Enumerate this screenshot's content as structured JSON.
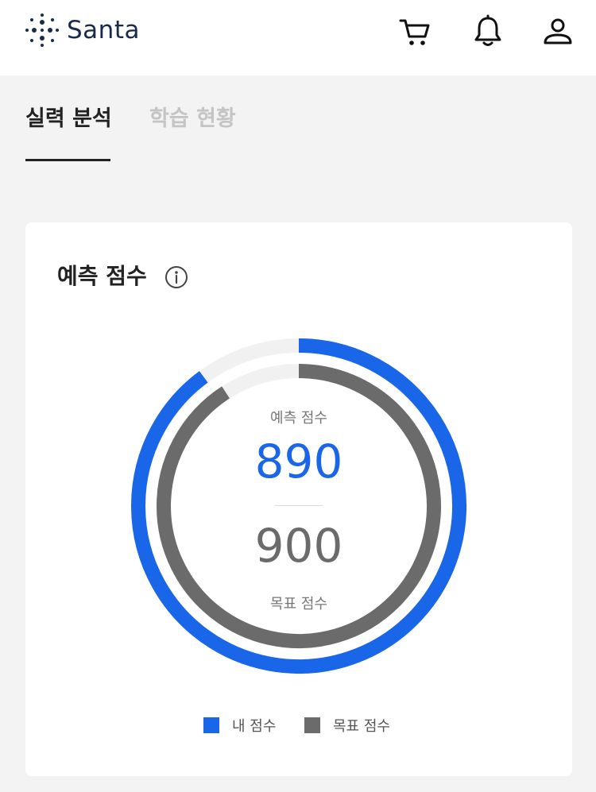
{
  "header": {
    "logo_text": "Santa",
    "icons": [
      "cart-icon",
      "bell-icon",
      "user-icon"
    ]
  },
  "tabs": [
    {
      "label": "실력 분석",
      "active": true
    },
    {
      "label": "학습 현황",
      "active": false
    }
  ],
  "card": {
    "title": "예측 점수",
    "gauge": {
      "predicted_label": "예측 점수",
      "predicted_value": "890",
      "target_label": "목표 점수",
      "target_value": "900",
      "max_score": 990
    },
    "legend": [
      {
        "label": "내 점수",
        "color": "#1a66e8"
      },
      {
        "label": "목표 점수",
        "color": "#6b6b6b"
      }
    ]
  },
  "colors": {
    "accent": "#1a66e8",
    "target": "#6b6b6b",
    "track": "#f1f1f1"
  }
}
